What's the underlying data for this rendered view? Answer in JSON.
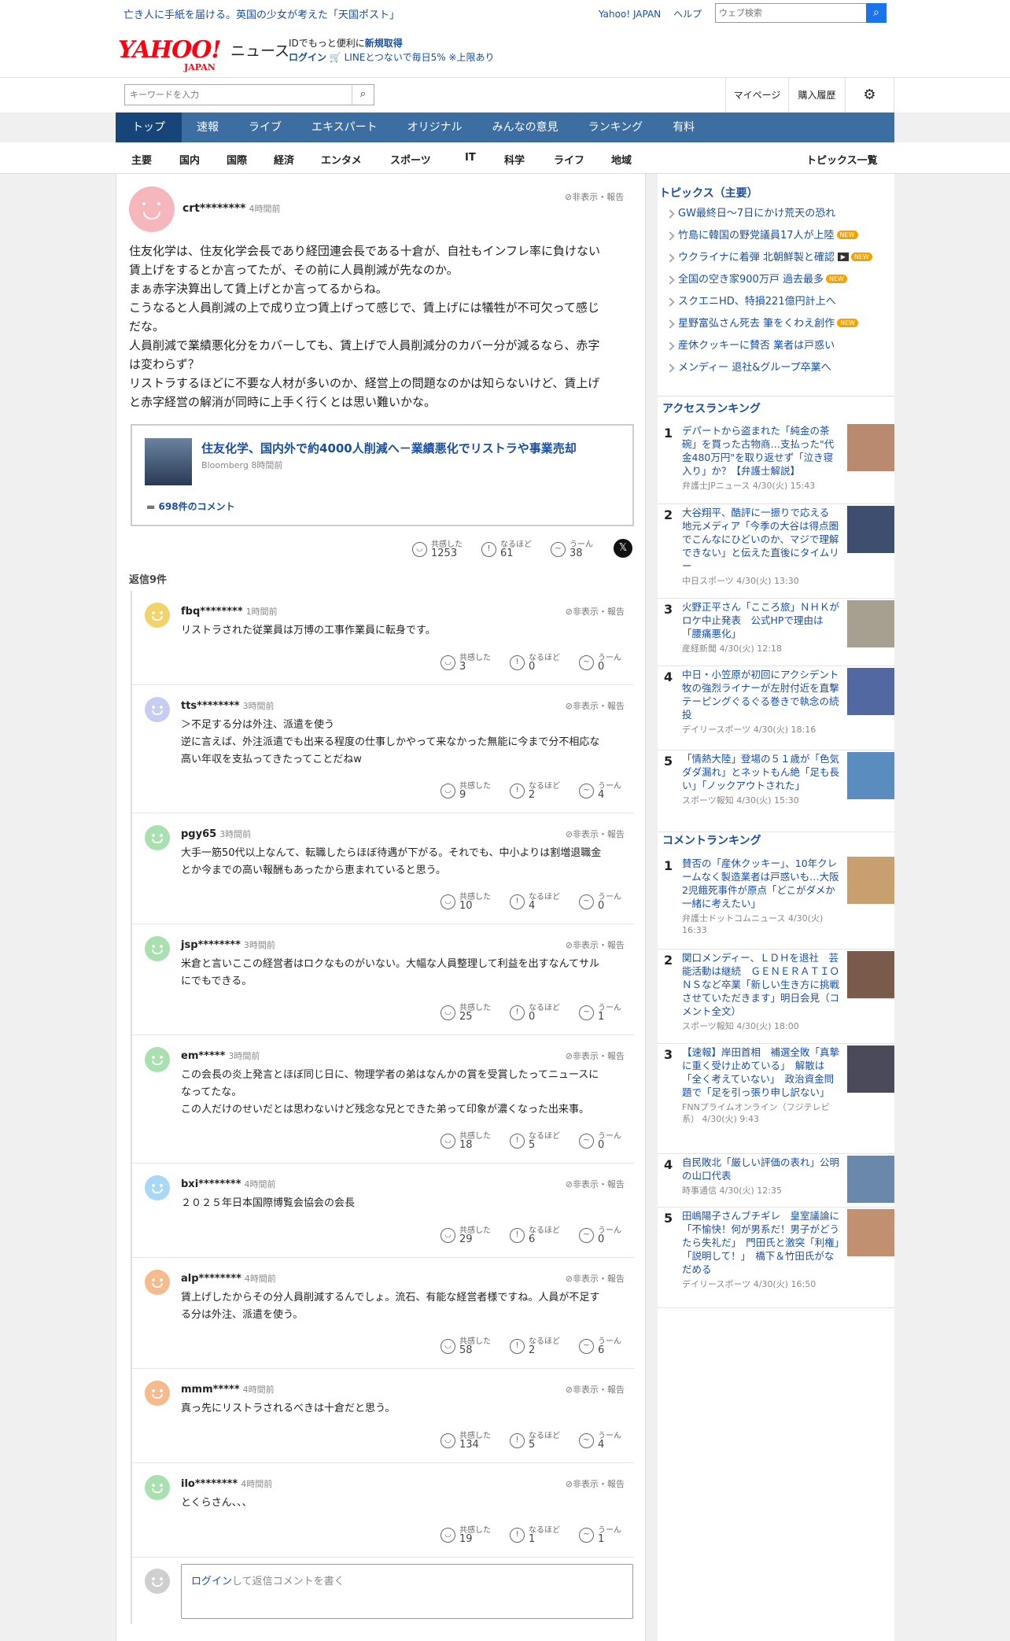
{
  "topbar": {
    "promo": "亡き人に手紙を届ける。英国の少女が考えた「天国ポスト」",
    "links": [
      "Yahoo! JAPAN",
      "ヘルプ"
    ],
    "search_placeholder": "ウェブ検索"
  },
  "header": {
    "logo": "YAHOO!",
    "logo_sub": "JAPAN",
    "news": "ニュース",
    "id_line1a": "IDでもっと便利に",
    "id_line1b": "新規取得",
    "login": "ログイン",
    "line_promo": "LINEとつないで毎日5% ※上限あり"
  },
  "search": {
    "placeholder": "キーワードを入力",
    "mypage": "マイページ",
    "history": "購入履歴"
  },
  "global_nav": [
    "トップ",
    "速報",
    "ライブ",
    "エキスパート",
    "オリジナル",
    "みんなの意見",
    "ランキング",
    "有料"
  ],
  "category_nav": [
    "主要",
    "国内",
    "国際",
    "経済",
    "エンタメ",
    "スポーツ",
    "IT",
    "科学",
    "ライフ",
    "地域"
  ],
  "topics_all": "トピックス一覧",
  "hide_report": "非表示・報告",
  "reaction_labels": [
    "共感した",
    "なるほど",
    "うーん"
  ],
  "main_comment": {
    "user": "crt********",
    "time": "4時間前",
    "lines": [
      "住友化学は、住友化学会長であり経団連会長である十倉が、自社もインフレ率に負けない",
      "賃上げをするとか言ってたが、その前に人員削減が先なのか。",
      "まぁ赤字決算出して賃上げとか言ってるからね。",
      "こうなると人員削減の上で成り立つ賃上げって感じで、賃上げには犠牲が不可欠って感じ",
      "だな。",
      "人員削減で業績悪化分をカバーしても、賃上げで人員削減分のカバー分が減るなら、赤字",
      "は変わらず？",
      "リストラするほどに不要な人材が多いのか、経営上の問題なのかは知らないけど、賃上げ",
      "と赤字経営の解消が同時に上手く行くとは思い難いかな。"
    ],
    "link": {
      "title": "住友化学、国内外で約4000人削減へ－業績悪化でリストラや事業売却",
      "source": "Bloomberg 8時間前",
      "comments": "698件のコメント"
    },
    "reactions": [
      "1253",
      "61",
      "38"
    ],
    "reply_count": "返信9件"
  },
  "replies": [
    {
      "user": "fbq********",
      "time": "1時間前",
      "color": "#f2d36b",
      "lines": [
        "リストラされた従業員は万博の工事作業員に転身です。"
      ],
      "reactions": [
        "3",
        "0",
        "0"
      ]
    },
    {
      "user": "tts********",
      "time": "3時間前",
      "color": "#c7cdf0",
      "lines": [
        "＞不足する分は外注、派遣を使う",
        "逆に言えば、外注派遣でも出来る程度の仕事しかやって来なかった無能に今まで分不相応な",
        "高い年収を支払ってきたってことだねw"
      ],
      "reactions": [
        "9",
        "2",
        "4"
      ]
    },
    {
      "user": "pgy65",
      "time": "3時間前",
      "color": "#a8e0b0",
      "lines": [
        "大手一筋50代以上なんて、転職したらほぼ待遇が下がる。それでも、中小よりは割増退職金",
        "とか今までの高い報酬もあったから恵まれていると思う。"
      ],
      "reactions": [
        "10",
        "4",
        "0"
      ]
    },
    {
      "user": "jsp********",
      "time": "3時間前",
      "color": "#a8e0b0",
      "lines": [
        "米倉と言いここの経営者はロクなものがいない。大幅な人員整理して利益を出すなんてサル",
        "にでもできる。"
      ],
      "reactions": [
        "25",
        "0",
        "1"
      ]
    },
    {
      "user": "em*****",
      "time": "3時間前",
      "color": "#a8e0b0",
      "lines": [
        "この会長の炎上発言とほぼ同じ日に、物理学者の弟はなんかの賞を受賞したってニュースに",
        "なってたな。",
        "この人だけのせいだとは思わないけど残念な兄とできた弟って印象が濃くなった出来事。"
      ],
      "reactions": [
        "18",
        "5",
        "0"
      ]
    },
    {
      "user": "bxi********",
      "time": "4時間前",
      "color": "#a8d8f5",
      "lines": [
        "２０２５年日本国際博覧会協会の会長"
      ],
      "reactions": [
        "29",
        "6",
        "0"
      ]
    },
    {
      "user": "alp********",
      "time": "4時間前",
      "color": "#f5bb8c",
      "lines": [
        "賃上げしたからその分人員削減するんでしょ。流石、有能な経営者様ですね。人員が不足す",
        "る分は外注、派遣を使う。"
      ],
      "reactions": [
        "58",
        "2",
        "6"
      ]
    },
    {
      "user": "mmm*****",
      "time": "4時間前",
      "color": "#f5bb8c",
      "lines": [
        "真っ先にリストラされるべきは十倉だと思う。"
      ],
      "reactions": [
        "134",
        "5",
        "4"
      ]
    },
    {
      "user": "ilo********",
      "time": "4時間前",
      "color": "#a8e0b0",
      "lines": [
        "とくらさん、、、"
      ],
      "reactions": [
        "19",
        "1",
        "1"
      ]
    }
  ],
  "reply_box": {
    "login": "ログイン",
    "text": "して返信コメントを書く"
  },
  "sidebar": {
    "topics_title": "トピックス（主要）",
    "topics": [
      {
        "text": "GW最終日～7日にかけ荒天の恐れ",
        "badge": ""
      },
      {
        "text": "竹島に韓国の野党議員17人が上陸",
        "badge": "NEW"
      },
      {
        "text": "ウクライナに着弾 北朝鮮製と確認",
        "badge": "NEW",
        "play": "▶"
      },
      {
        "text": "全国の空き家900万戸 過去最多",
        "badge": "NEW"
      },
      {
        "text": "スクエニHD、特損221億円計上へ",
        "badge": ""
      },
      {
        "text": "星野富弘さん死去 筆をくわえ創作",
        "badge": "NEW"
      },
      {
        "text": "産休クッキーに賛否 業者は戸惑い",
        "badge": ""
      },
      {
        "text": "メンディー 退社&グループ卒業へ",
        "badge": ""
      }
    ],
    "access_title": "アクセスランキング",
    "access": [
      {
        "no": "1",
        "title": "デパートから盗まれた「純金の茶碗」を買った古物商…支払った\"代金480万円\"を取り返せず「泣き寝入り」か？【弁護士解説】",
        "source": "弁護士JPニュース 4/30(火) 15:43",
        "img": "#b98a70"
      },
      {
        "no": "2",
        "title": "大谷翔平、酷評に一振りで応える　地元メディア「今季の大谷は得点圏でこんなにひどいのか、マジで理解できない」と伝えた直後にタイムリー",
        "source": "中日スポーツ 4/30(火) 13:30",
        "img": "#3d4e6e"
      },
      {
        "no": "3",
        "title": "火野正平さん「こころ旅」ＮＨＫがロケ中止発表　公式HPで理由は「腰痛悪化」",
        "source": "産経新聞 4/30(火) 12:18",
        "img": "#a7a090"
      },
      {
        "no": "4",
        "title": "中日・小笠原が初回にアクシデント　牧の強烈ライナーが左肘付近を直撃　テーピングぐるぐる巻きで執念の続投",
        "source": "デイリースポーツ 4/30(火) 18:16",
        "img": "#5268a0"
      },
      {
        "no": "5",
        "title": "「情熱大陸」登場の５１歳が「色気ダダ漏れ」とネットもん絶「足も長い」「ノックアウトされた」",
        "source": "スポーツ報知 4/30(火) 15:30",
        "img": "#5a8cc0"
      }
    ],
    "comment_title": "コメントランキング",
    "comments": [
      {
        "no": "1",
        "title": "賛否の「産休クッキー」、10年クレームなく製造業者は戸惑いも…大阪2児餓死事件が原点「どこがダメか一緒に考えたい」",
        "source": "弁護士ドットコムニュース 4/30(火) 16:33",
        "img": "#c8a070"
      },
      {
        "no": "2",
        "title": "関口メンディー、ＬＤＨを退社　芸能活動は継続　ＧＥＮＥＲＡＴＩＯＮＳなど卒業「新しい生き方に挑戦させていただきます」明日会見（コメント全文）",
        "source": "スポーツ報知 4/30(火) 18:00",
        "img": "#7a5a4a"
      },
      {
        "no": "3",
        "title": "【速報】岸田首相　補選全敗「真摯に重く受け止めている」　解散は「全く考えていない」　政治資金問題で「足を引っ張り申し訳ない」",
        "source": "FNNプライムオンライン（フジテレビ系） 4/30(火) 9:43",
        "img": "#4a4a5a"
      },
      {
        "no": "4",
        "title": "自民敗北「厳しい評価の表れ」公明の山口代表",
        "source": "時事通信 4/30(火) 12:35",
        "img": "#6a88aa"
      },
      {
        "no": "5",
        "title": "田嶋陽子さんブチギレ　皇室議論に「不愉快！何が男系だ！男子がどうたら失礼だ」　門田氏と激突「利権」「説明して！」　橋下＆竹田氏がなだめる",
        "source": "デイリースポーツ 4/30(火) 16:50",
        "img": "#c09070"
      }
    ]
  }
}
